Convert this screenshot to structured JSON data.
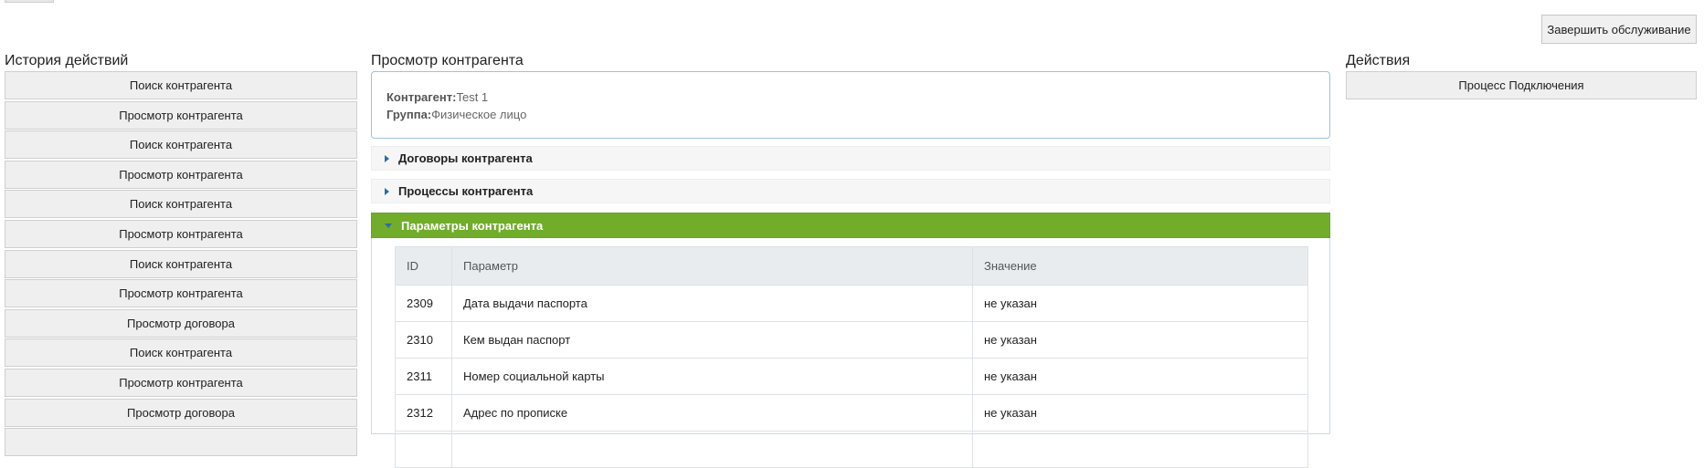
{
  "header": {
    "finish_button": "Завершить обслуживание"
  },
  "history": {
    "title": "История действий",
    "items": [
      "Поиск контрагента",
      "Просмотр контрагента",
      "Поиск контрагента",
      "Просмотр контрагента",
      "Поиск контрагента",
      "Просмотр контрагента",
      "Поиск контрагента",
      "Просмотр контрагента",
      "Просмотр договора",
      "Поиск контрагента",
      "Просмотр контрагента",
      "Просмотр договора",
      ""
    ]
  },
  "main": {
    "title": "Просмотр контрагента",
    "info": {
      "counterparty_label": "Контрагент:",
      "counterparty_value": "Test 1",
      "group_label": "Группа:",
      "group_value": "Физическое лицо"
    },
    "sections": [
      {
        "label": "Договоры контрагента",
        "expanded": false
      },
      {
        "label": "Процессы контрагента",
        "expanded": false
      },
      {
        "label": "Параметры контрагента",
        "expanded": true
      }
    ],
    "params_table": {
      "columns": [
        "ID",
        "Параметр",
        "Значение"
      ],
      "rows": [
        [
          "2309",
          "Дата выдачи паспорта",
          "не указан"
        ],
        [
          "2310",
          "Кем выдан паспорт",
          "не указан"
        ],
        [
          "2311",
          "Номер социальной карты",
          "не указан"
        ],
        [
          "2312",
          "Адрес по прописке",
          "не указан"
        ],
        [
          "",
          "",
          ""
        ]
      ]
    },
    "colors": {
      "active_section": "#71ad2b",
      "info_border": "#9ec3de"
    }
  },
  "actions": {
    "title": "Действия",
    "buttons": [
      "Процесс Подключения"
    ]
  }
}
